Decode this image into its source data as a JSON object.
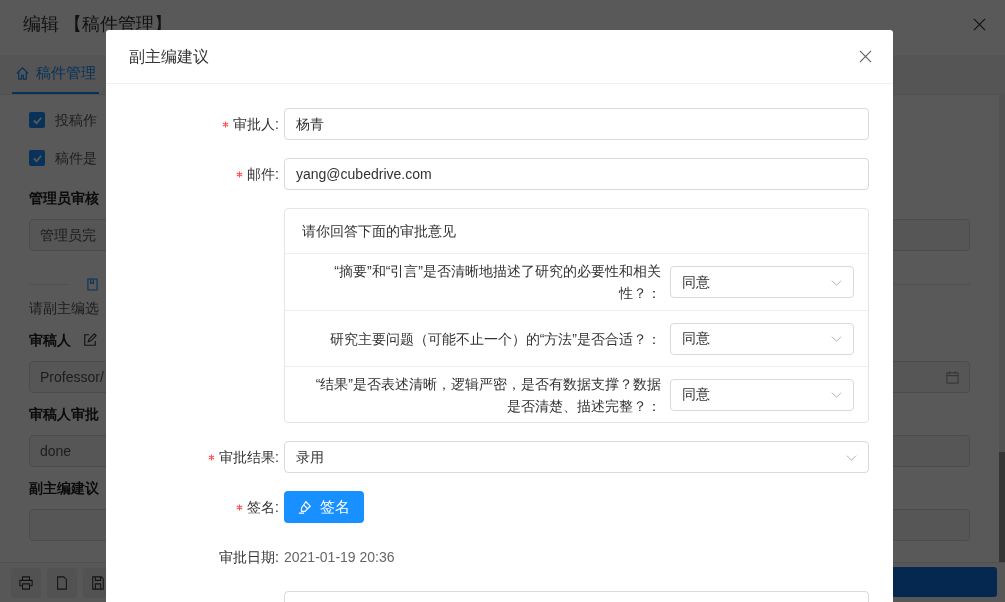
{
  "app": {
    "title": "编辑 【稿件管理】",
    "tabs": [
      {
        "label": "稿件管理",
        "selected": true
      }
    ],
    "checkboxes": [
      {
        "label": "投稿作",
        "checked": true
      },
      {
        "label": "稿件是",
        "checked": true
      }
    ],
    "sections": [
      {
        "kind": "field",
        "heading": "管理员审核",
        "value": "管理员完"
      },
      {
        "kind": "divider"
      },
      {
        "kind": "note",
        "text": "请副主编选"
      },
      {
        "kind": "field",
        "heading": "审稿人",
        "edit_icon": true,
        "value": "Professor/",
        "date_icon": true
      },
      {
        "kind": "field",
        "heading": "审稿人审批",
        "value": "done"
      },
      {
        "kind": "field",
        "heading": "副主编建议"
      }
    ]
  },
  "dialog": {
    "title": "副主编建议",
    "rows": [
      {
        "kind": "input",
        "label": "审批人:",
        "required": true,
        "value": "杨青"
      },
      {
        "kind": "input",
        "label": "邮件:",
        "required": true,
        "value": "yang@cubedrive.com"
      },
      {
        "kind": "questions",
        "header": "请你回答下面的审批意见",
        "items": [
          {
            "question": "“摘要”和“引言”是否清晰地描述了研究的必要性和相关性？：",
            "answer": "同意"
          },
          {
            "question": "研究主要问题（可能不止一个）的“方法”是否合适？：",
            "answer": "同意"
          },
          {
            "question": "“结果”是否表述清晰，逻辑严密，是否有数据支撑？数据是否清楚、描述完整？：",
            "answer": "同意"
          }
        ]
      },
      {
        "kind": "select",
        "label": "审批结果:",
        "required": true,
        "value": "录用"
      },
      {
        "kind": "button",
        "label": "签名:",
        "required": true,
        "text": "签名"
      },
      {
        "kind": "text",
        "label": "审批日期:",
        "required": false,
        "value": "2021-01-19 20:36"
      },
      {
        "kind": "input",
        "required": false
      }
    ]
  }
}
